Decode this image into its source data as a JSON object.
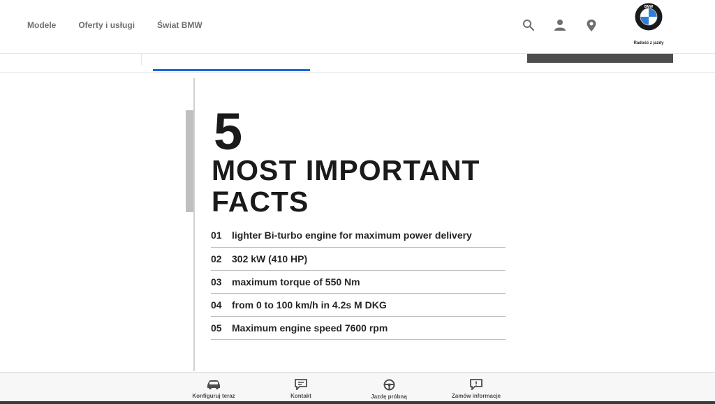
{
  "header": {
    "nav": [
      {
        "label": "Modele"
      },
      {
        "label": "Oferty i usługi"
      },
      {
        "label": "Świat BMW"
      }
    ],
    "icons": [
      "search-icon",
      "user-icon",
      "location-pin-icon"
    ],
    "logo": {
      "letters": "BMW",
      "tagline": "Radość z jazdy"
    }
  },
  "main": {
    "number": "5",
    "headline": "MOST IMPORTANT FACTS",
    "facts": [
      {
        "num": "01",
        "text": "lighter Bi-turbo engine for maximum power delivery"
      },
      {
        "num": "02",
        "text": "302 kW (410 HP)"
      },
      {
        "num": "03",
        "text": "maximum torque of 550 Nm"
      },
      {
        "num": "04",
        "text": "from 0 to 100 km/h in 4.2s M DKG"
      },
      {
        "num": "05",
        "text": "Maximum engine speed 7600 rpm"
      }
    ]
  },
  "bottom_bar": {
    "items": [
      {
        "label": "Konfiguruj teraz",
        "icon": "car-icon"
      },
      {
        "label": "Kontakt",
        "icon": "chat-icon"
      },
      {
        "label": "Jazdę próbną",
        "icon": "steering-wheel-icon"
      },
      {
        "label": "Zamów informacje",
        "icon": "info-bubble-icon"
      }
    ]
  },
  "colors": {
    "accent": "#1c69d4",
    "text": "#262626",
    "nav_text": "#6f6f6f"
  }
}
